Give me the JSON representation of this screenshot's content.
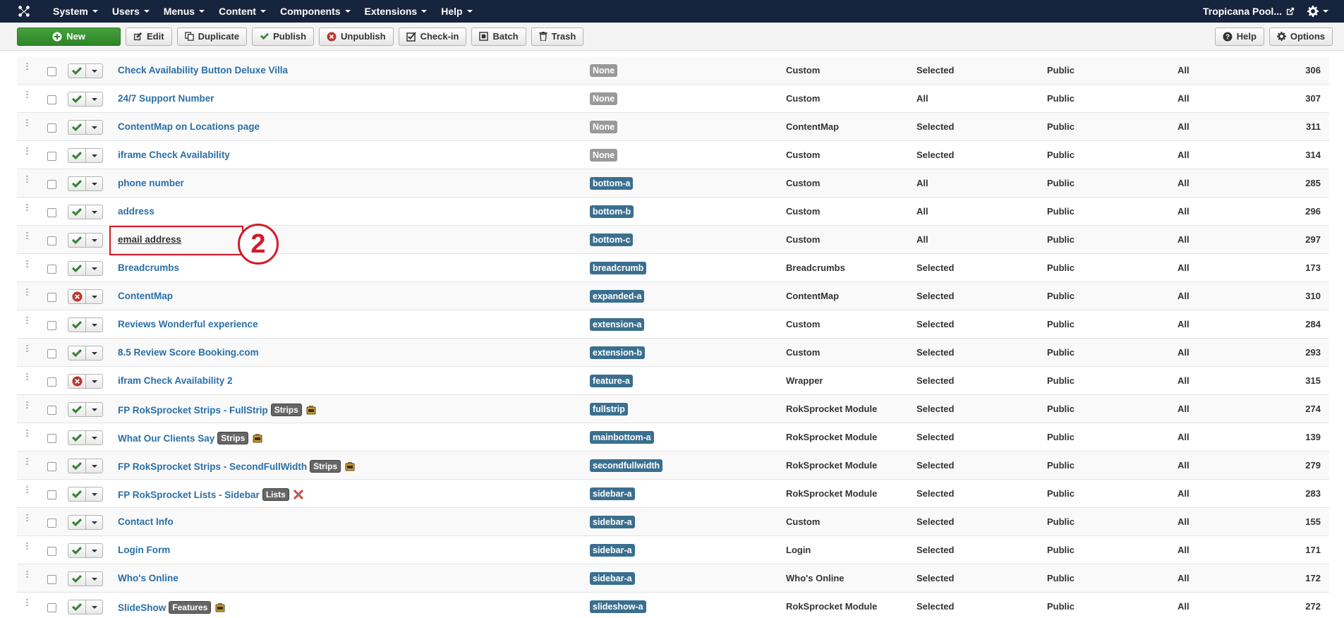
{
  "nav": {
    "menus": [
      "System",
      "Users",
      "Menus",
      "Content",
      "Components",
      "Extensions",
      "Help"
    ],
    "site_name": "Tropicana Pool..."
  },
  "toolbar": {
    "new_label": "New",
    "edit_label": "Edit",
    "duplicate_label": "Duplicate",
    "publish_label": "Publish",
    "unpublish_label": "Unpublish",
    "checkin_label": "Check-in",
    "batch_label": "Batch",
    "trash_label": "Trash",
    "help_label": "Help",
    "options_label": "Options"
  },
  "annotation": {
    "number": "2"
  },
  "rows": [
    {
      "title": "Check Availability Button Deluxe Villa",
      "published": true,
      "position": "None",
      "type": "Custom",
      "pages": "Selected",
      "access": "Public",
      "language": "All",
      "id": "306"
    },
    {
      "title": "24/7 Support Number",
      "published": true,
      "position": "None",
      "type": "Custom",
      "pages": "All",
      "access": "Public",
      "language": "All",
      "id": "307"
    },
    {
      "title": "ContentMap on Locations page",
      "published": true,
      "position": "None",
      "type": "ContentMap",
      "pages": "Selected",
      "access": "Public",
      "language": "All",
      "id": "311"
    },
    {
      "title": "iframe Check Availability",
      "published": true,
      "position": "None",
      "type": "Custom",
      "pages": "Selected",
      "access": "Public",
      "language": "All",
      "id": "314"
    },
    {
      "title": "phone number",
      "published": true,
      "position": "bottom-a",
      "type": "Custom",
      "pages": "All",
      "access": "Public",
      "language": "All",
      "id": "285"
    },
    {
      "title": "address",
      "published": true,
      "position": "bottom-b",
      "type": "Custom",
      "pages": "All",
      "access": "Public",
      "language": "All",
      "id": "296"
    },
    {
      "title": "email address",
      "published": true,
      "position": "bottom-c",
      "type": "Custom",
      "pages": "All",
      "access": "Public",
      "language": "All",
      "id": "297"
    },
    {
      "title": "Breadcrumbs",
      "published": true,
      "position": "breadcrumb",
      "type": "Breadcrumbs",
      "pages": "Selected",
      "access": "Public",
      "language": "All",
      "id": "173"
    },
    {
      "title": "ContentMap",
      "published": false,
      "position": "expanded-a",
      "type": "ContentMap",
      "pages": "Selected",
      "access": "Public",
      "language": "All",
      "id": "310"
    },
    {
      "title": "Reviews Wonderful experience",
      "published": true,
      "position": "extension-a",
      "type": "Custom",
      "pages": "Selected",
      "access": "Public",
      "language": "All",
      "id": "284"
    },
    {
      "title": "8.5 Review Score Booking.com",
      "published": true,
      "position": "extension-b",
      "type": "Custom",
      "pages": "Selected",
      "access": "Public",
      "language": "All",
      "id": "293"
    },
    {
      "title": "ifram Check Availability 2",
      "published": false,
      "position": "feature-a",
      "type": "Wrapper",
      "pages": "Selected",
      "access": "Public",
      "language": "All",
      "id": "315"
    },
    {
      "title": "FP RokSprocket Strips - FullStrip",
      "badge": "Strips",
      "published": true,
      "position": "fullstrip",
      "type": "RokSprocket Module",
      "pages": "Selected",
      "access": "Public",
      "language": "All",
      "id": "274"
    },
    {
      "title": "What Our Clients Say",
      "badge": "Strips",
      "published": true,
      "position": "mainbottom-a",
      "type": "RokSprocket Module",
      "pages": "Selected",
      "access": "Public",
      "language": "All",
      "id": "139"
    },
    {
      "title": "FP RokSprocket Strips - SecondFullWidth",
      "badge": "Strips",
      "published": true,
      "position": "secondfullwidth",
      "type": "RokSprocket Module",
      "pages": "Selected",
      "access": "Public",
      "language": "All",
      "id": "279"
    },
    {
      "title": "FP RokSprocket Lists - Sidebar",
      "badge": "Lists",
      "published": true,
      "position": "sidebar-a",
      "type": "RokSprocket Module",
      "pages": "Selected",
      "access": "Public",
      "language": "All",
      "id": "283"
    },
    {
      "title": "Contact Info",
      "published": true,
      "position": "sidebar-a",
      "type": "Custom",
      "pages": "Selected",
      "access": "Public",
      "language": "All",
      "id": "155"
    },
    {
      "title": "Login Form",
      "published": true,
      "position": "sidebar-a",
      "type": "Login",
      "pages": "Selected",
      "access": "Public",
      "language": "All",
      "id": "171"
    },
    {
      "title": "Who's Online",
      "published": true,
      "position": "sidebar-a",
      "type": "Who's Online",
      "pages": "Selected",
      "access": "Public",
      "language": "All",
      "id": "172"
    },
    {
      "title": "SlideShow",
      "badge": "Features",
      "published": true,
      "position": "slideshow-a",
      "type": "RokSprocket Module",
      "pages": "Selected",
      "access": "Public",
      "language": "All",
      "id": "272"
    }
  ]
}
